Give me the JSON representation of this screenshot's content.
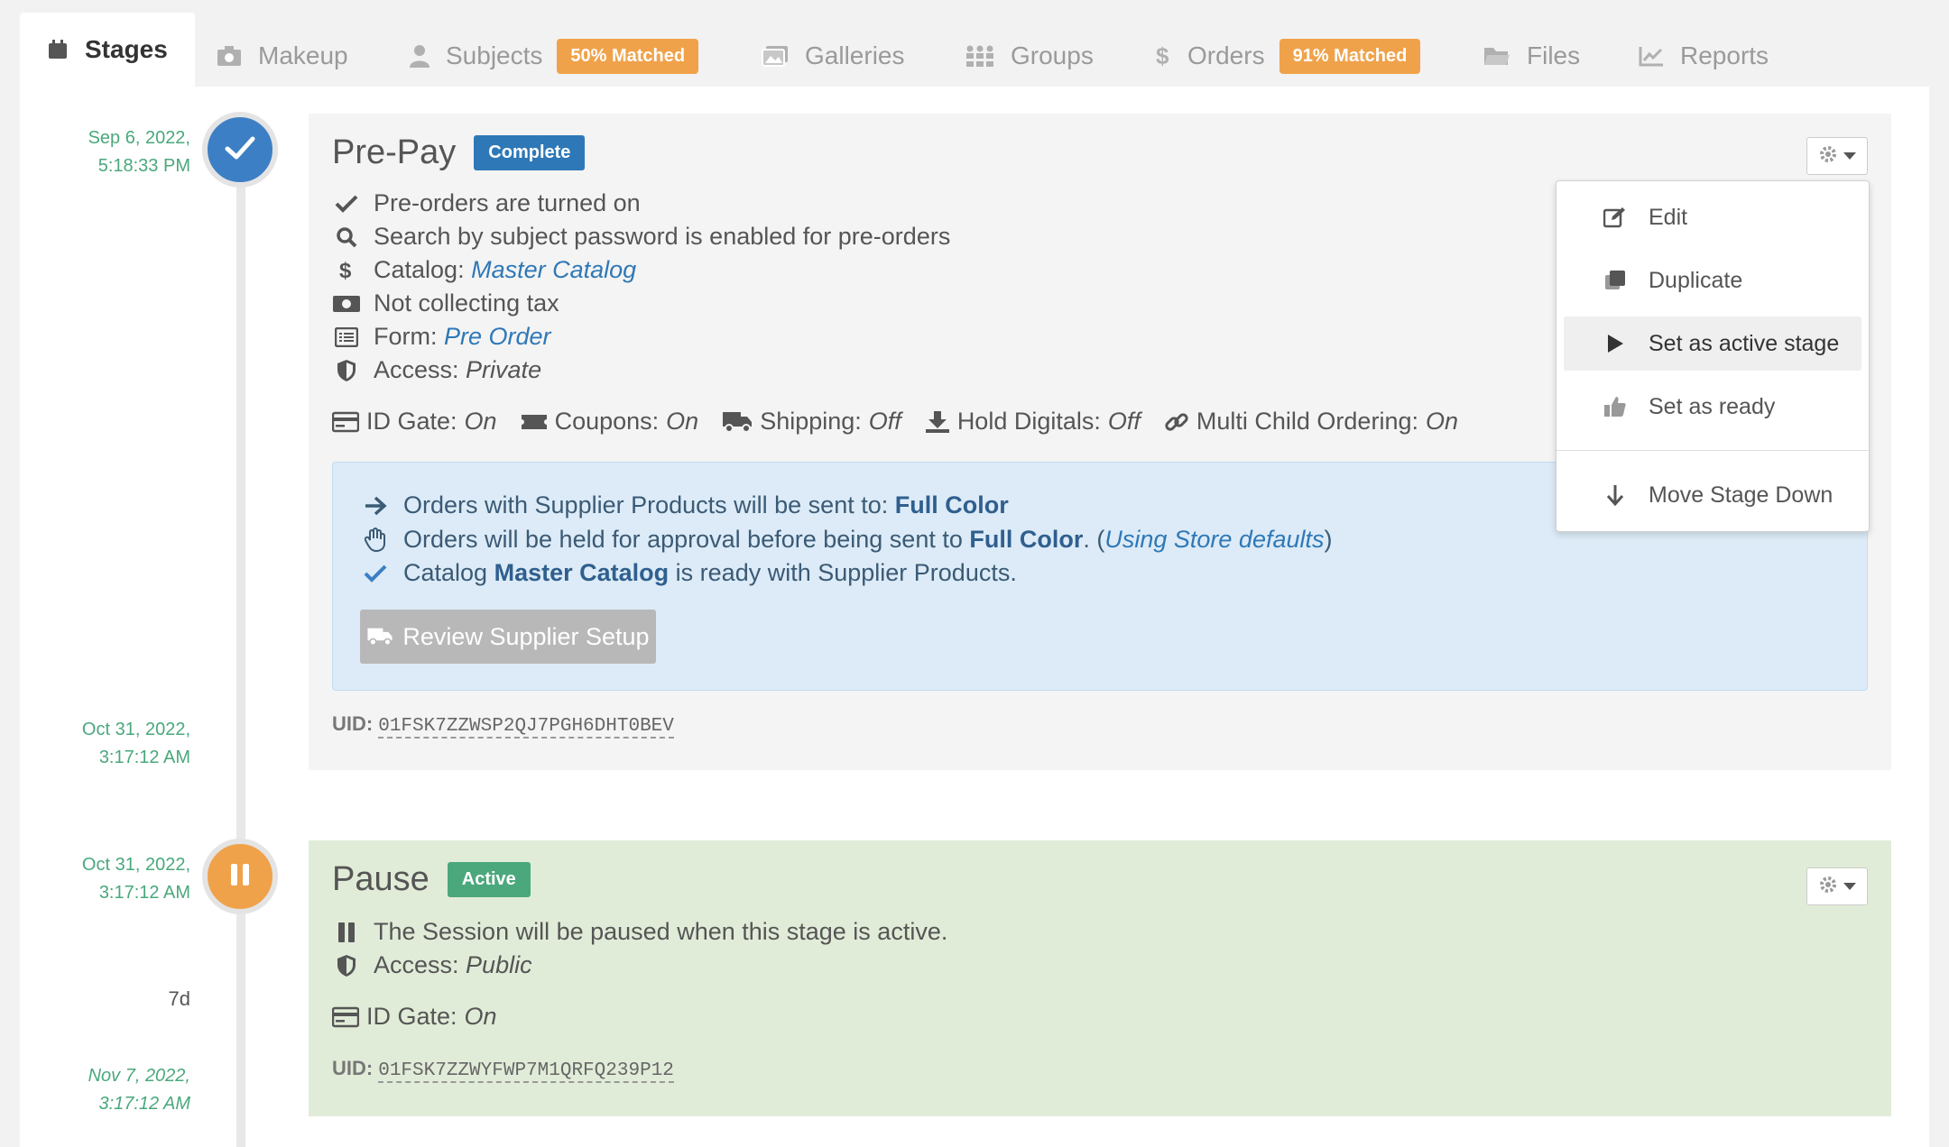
{
  "tabs": [
    {
      "label": "Stages",
      "icon": "calendar-icon",
      "active": true
    },
    {
      "label": "Makeup",
      "icon": "camera-icon"
    },
    {
      "label": "Subjects",
      "icon": "user-icon",
      "badge": "50% Matched"
    },
    {
      "label": "Galleries",
      "icon": "image-icon"
    },
    {
      "label": "Groups",
      "icon": "group-icon"
    },
    {
      "label": "Orders",
      "icon": "dollar-icon",
      "badge": "91% Matched"
    },
    {
      "label": "Files",
      "icon": "folder-icon"
    },
    {
      "label": "Reports",
      "icon": "chart-icon"
    }
  ],
  "timeline": {
    "prepay_start_date": "Sep 6, 2022,",
    "prepay_start_time": "5:18:33 PM",
    "prepay_end_date": "Oct 31, 2022,",
    "prepay_end_time": "3:17:12 AM",
    "pause_start_date": "Oct 31, 2022,",
    "pause_start_time": "3:17:12 AM",
    "pause_duration": "7d",
    "pause_end_date": "Nov 7, 2022,",
    "pause_end_time": "3:17:12 AM"
  },
  "prepay": {
    "title": "Pre-Pay",
    "status": "Complete",
    "status_color": "#2f78b7",
    "items": {
      "preorders": "Pre-orders are turned on",
      "search": "Search by subject password is enabled for pre-orders",
      "catalog_label": "Catalog:",
      "catalog_value": "Master Catalog",
      "tax": "Not collecting tax",
      "form_label": "Form:",
      "form_value": "Pre Order",
      "access_label": "Access:",
      "access_value": "Private"
    },
    "flags": {
      "id_gate_label": "ID Gate:",
      "id_gate_value": "On",
      "coupons_label": "Coupons:",
      "coupons_value": "On",
      "shipping_label": "Shipping:",
      "shipping_value": "Off",
      "hold_label": "Hold Digitals:",
      "hold_value": "Off",
      "multi_label": "Multi Child Ordering:",
      "multi_value": "On"
    },
    "supplier": {
      "line1_text": "Orders with Supplier Products will be sent to:",
      "line1_value": "Full Color",
      "line2_text": "Orders will be held for approval before being sent to",
      "line2_value": "Full Color",
      "line2_suffix_a": ". (",
      "line2_note": "Using Store defaults",
      "line2_suffix_b": " )",
      "line3_pre": "Catalog",
      "line3_value": "Master Catalog",
      "line3_post": "is ready with Supplier Products.",
      "button": "Review Supplier Setup"
    },
    "uid_label": "UID:",
    "uid": "01FSK7ZZWSP2QJ7PGH6DHT0BEV"
  },
  "pause": {
    "title": "Pause",
    "status": "Active",
    "status_color": "#4aa87c",
    "line1": "The Session will be paused when this stage is active.",
    "access_label": "Access:",
    "access_value": "Public",
    "id_gate_label": "ID Gate:",
    "id_gate_value": "On",
    "uid_label": "UID:",
    "uid": "01FSK7ZZWYFWP7M1QRFQ239P12"
  },
  "menu": {
    "edit": "Edit",
    "duplicate": "Duplicate",
    "set_active": "Set as active stage",
    "set_ready": "Set as ready",
    "move_down": "Move Stage Down"
  },
  "colors": {
    "accent_blue": "#2f78b7",
    "complete_node": "#3d7fc4",
    "pause_node": "#f0a24a",
    "badge_orange": "#f0a24a"
  }
}
